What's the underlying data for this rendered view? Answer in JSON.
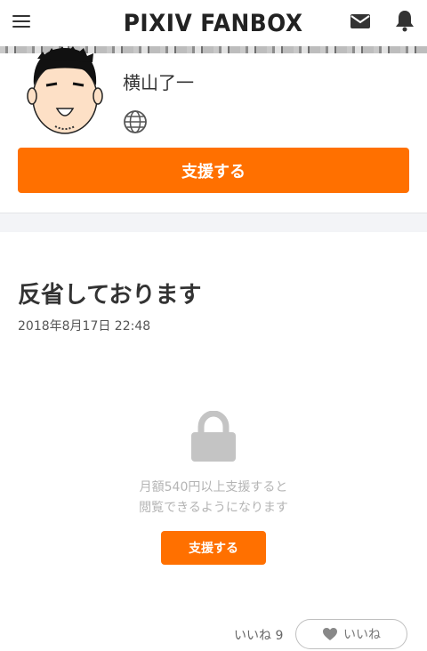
{
  "header": {
    "logo": "PIXIV FANBOX",
    "menu_icon": "hamburger-menu-icon",
    "mail_icon": "mail-icon",
    "bell_icon": "bell-icon"
  },
  "creator": {
    "name": "横山了一",
    "globe_icon": "globe-icon"
  },
  "support_button": "支援する",
  "post": {
    "title": "反省しております",
    "date": "2018年8月17日 22:48"
  },
  "locked": {
    "lock_icon": "lock-icon",
    "line1": "月額540円以上支援すると",
    "line2": "閲覧できるようになります",
    "button": "支援する"
  },
  "likes": {
    "count_label": "いいね 9",
    "button_label": "いいね",
    "heart_icon": "heart-icon"
  },
  "colors": {
    "accent": "#ff7000",
    "text": "#333333",
    "muted": "#b4b4b4"
  }
}
